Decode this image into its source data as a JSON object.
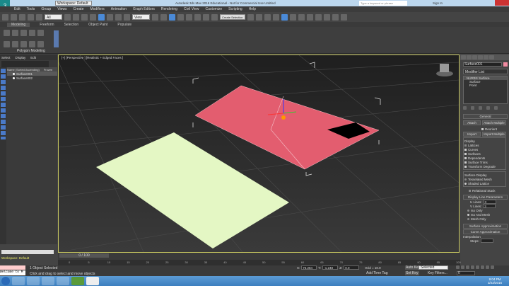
{
  "title": {
    "app_title": "Autodesk 3ds Max 2016 Educational - Not for Commercial Use   Untitled",
    "workspace": "Workspace: Default",
    "search_placeholder": "Type a keyword or phrase",
    "sign_in": "Sign In"
  },
  "menu": [
    "Edit",
    "Tools",
    "Group",
    "Views",
    "Create",
    "Modifiers",
    "Animation",
    "Graph Editors",
    "Rendering",
    "Civil View",
    "Customize",
    "Scripting",
    "Help"
  ],
  "toolbar": {
    "selection_filter": "All",
    "ref_coord": "View",
    "named_selection": "Create Selection Set"
  },
  "ribbon": {
    "tabs": [
      "Modeling",
      "Freeform",
      "Selection",
      "Object Paint",
      "Populate"
    ],
    "panel_label": "Polygon Modeling"
  },
  "explorer": {
    "menu": [
      "Select",
      "Display",
      "Edit"
    ],
    "column_name": "Name (Sorted Ascending)",
    "column_2": "Frozen",
    "items": [
      "Surface001",
      "Surface002"
    ]
  },
  "viewport": {
    "label": "[+] [Perspective ] [Realistic + Edged Faces ]",
    "colors": {
      "plane": "#e4f7c4",
      "surface": "#e35d6f"
    }
  },
  "cmd": {
    "object_name": "Surface001",
    "object_color": "#f08aa0",
    "modifier_list": "Modifier List",
    "stack": [
      "NURBS Surface",
      "Surface",
      "Point"
    ],
    "general": "General",
    "attach": "Attach",
    "attach_multiple": "Attach Multiple",
    "reorient": "Reorient",
    "import": "Import",
    "import_multiple": "Import Multiple",
    "display": "Display",
    "display_items": [
      {
        "label": "Lattices",
        "checked": false
      },
      {
        "label": "Curves",
        "checked": true
      },
      {
        "label": "Surfaces",
        "checked": true
      },
      {
        "label": "Dependents",
        "checked": true
      },
      {
        "label": "Surface Trims",
        "checked": true
      },
      {
        "label": "Transform Degrade",
        "checked": true
      }
    ],
    "surface_display": "Surface Display",
    "tess_mesh": "Tesselated Mesh",
    "shaded_lattice": "Shaded Lattice",
    "relational_stack": "Relational Stack",
    "dlp": "Display Line Parameters",
    "ulines_label": "U Lines:",
    "ulines": "3",
    "vlines_label": "V Lines:",
    "vlines": "3",
    "iso_only": "Iso Only",
    "iso_mesh": "Iso And Mesh",
    "mesh_only": "Mesh Only",
    "surface_approx": "Surface Approximation",
    "curve_approx": "Curve Approximation",
    "interpolation": "Interpolation",
    "steps_label": "Steps:"
  },
  "timeline": {
    "frame": "0 / 100",
    "ticks": [
      "0",
      "5",
      "10",
      "15",
      "20",
      "25",
      "30",
      "35",
      "40",
      "45",
      "50",
      "55",
      "60",
      "65",
      "70",
      "75",
      "80",
      "85",
      "90",
      "95",
      "100"
    ]
  },
  "status": {
    "selected": "1 Object Selected",
    "prompt": "Click and drag to select and move objects",
    "listener": "Welcome to M",
    "x_label": "X:",
    "x": "76.284",
    "y_label": "Y:",
    "y": "-1.248",
    "z_label": "Z:",
    "z": "0.0",
    "grid": "Grid = 10.0",
    "add_time_tag": "Add Time Tag",
    "auto_key": "Auto Key",
    "set_key": "Set Key",
    "key_mode": "Selected",
    "key_filters": "Key Filters...",
    "frame": "0"
  },
  "taskbar": {
    "time": "9:04 PM",
    "date": "3/23/2016"
  }
}
